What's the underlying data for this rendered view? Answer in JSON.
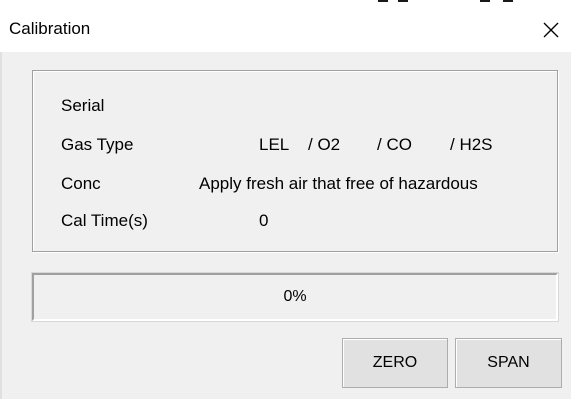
{
  "window": {
    "title": "Calibration",
    "close_icon": "close-icon"
  },
  "info": {
    "serial_label": "Serial",
    "serial_value": "",
    "gas_type_label": "Gas Type",
    "gas_types": [
      "LEL",
      "/ O2",
      "/ CO",
      "/ H2S"
    ],
    "conc_label": "Conc",
    "conc_value": "Apply fresh air that free of hazardous",
    "cal_time_label": "Cal Time(s)",
    "cal_time_value": "0"
  },
  "progress": {
    "value_percent": 0,
    "text": "0%"
  },
  "buttons": {
    "zero_label": "ZERO",
    "span_label": "SPAN"
  }
}
